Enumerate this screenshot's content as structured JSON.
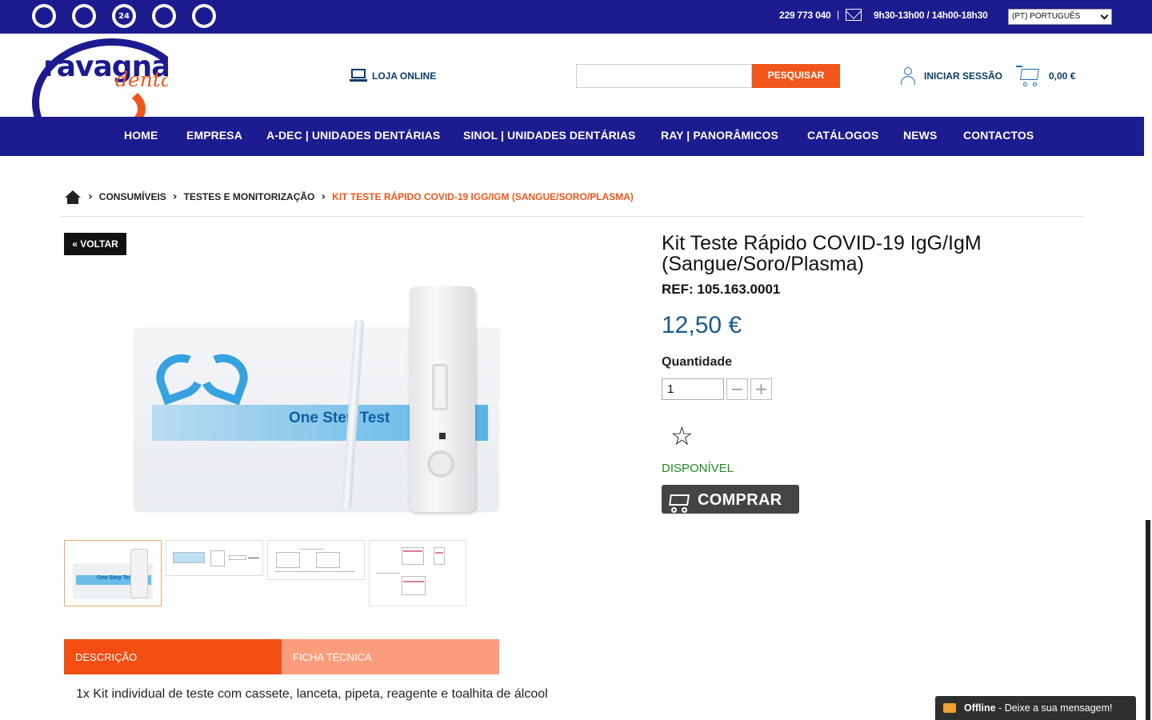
{
  "topbar": {
    "icons": [
      "truck-icon",
      "ribbon-icon",
      "24h-icon",
      "support-icon",
      "refresh-icon"
    ],
    "icon_labels": [
      "",
      "",
      "24",
      "",
      ""
    ],
    "phone": "229 773 040",
    "separator": "|",
    "hours": "9h30-13h00 / 14h00-18h30",
    "language": "(PT) PORTUGUÊS"
  },
  "header": {
    "logo_main": "ravagnani",
    "logo_sub": "dental",
    "loja_label": "LOJA ONLINE",
    "search_placeholder": "",
    "search_button": "PESQUISAR",
    "login_label": "INICIAR SESSÃO",
    "cart_total": "0,00 €"
  },
  "nav": {
    "items": [
      "HOME",
      "EMPRESA",
      "A-DEC | UNIDADES DENTÁRIAS",
      "SINOL | UNIDADES DENTÁRIAS",
      "RAY | PANORÂMICOS",
      "CATÁLOGOS",
      "NEWS",
      "CONTACTOS"
    ]
  },
  "breadcrumb": {
    "items": [
      "CONSUMÍVEIS",
      "TESTES E MONITORIZAÇÃO"
    ],
    "current": "KIT TESTE RÁPIDO COVID-19 IGG/IGM (SANGUE/SORO/PLASMA)"
  },
  "product": {
    "back_label": "« VOLTAR",
    "image_text": "One Step Test",
    "thumb_text": "One Step Test",
    "title": "Kit Teste Rápido COVID-19 IgG/IgM (Sangue/Soro/Plasma)",
    "ref": "REF: 105.163.0001",
    "price": "12,50 €",
    "qty_label": "Quantidade",
    "qty_value": "1",
    "qty_minus": "−",
    "qty_plus": "+",
    "availability": "DISPONÍVEL",
    "buy_label": "COMPRAR"
  },
  "tabs": {
    "description": "DESCRIÇÃO",
    "datasheet": "FICHA TÉCNICA",
    "description_text": "1x Kit individual de teste com cassete, lanceta, pipeta, reagente e toalhita de álcool"
  },
  "chat": {
    "status": "Offline",
    "message": " - Deixe a sua mensagem!"
  },
  "colors": {
    "brand_blue": "#1c1b8f",
    "accent_orange": "#f0561c",
    "price_blue": "#175b8e",
    "available_green": "#228b22"
  }
}
